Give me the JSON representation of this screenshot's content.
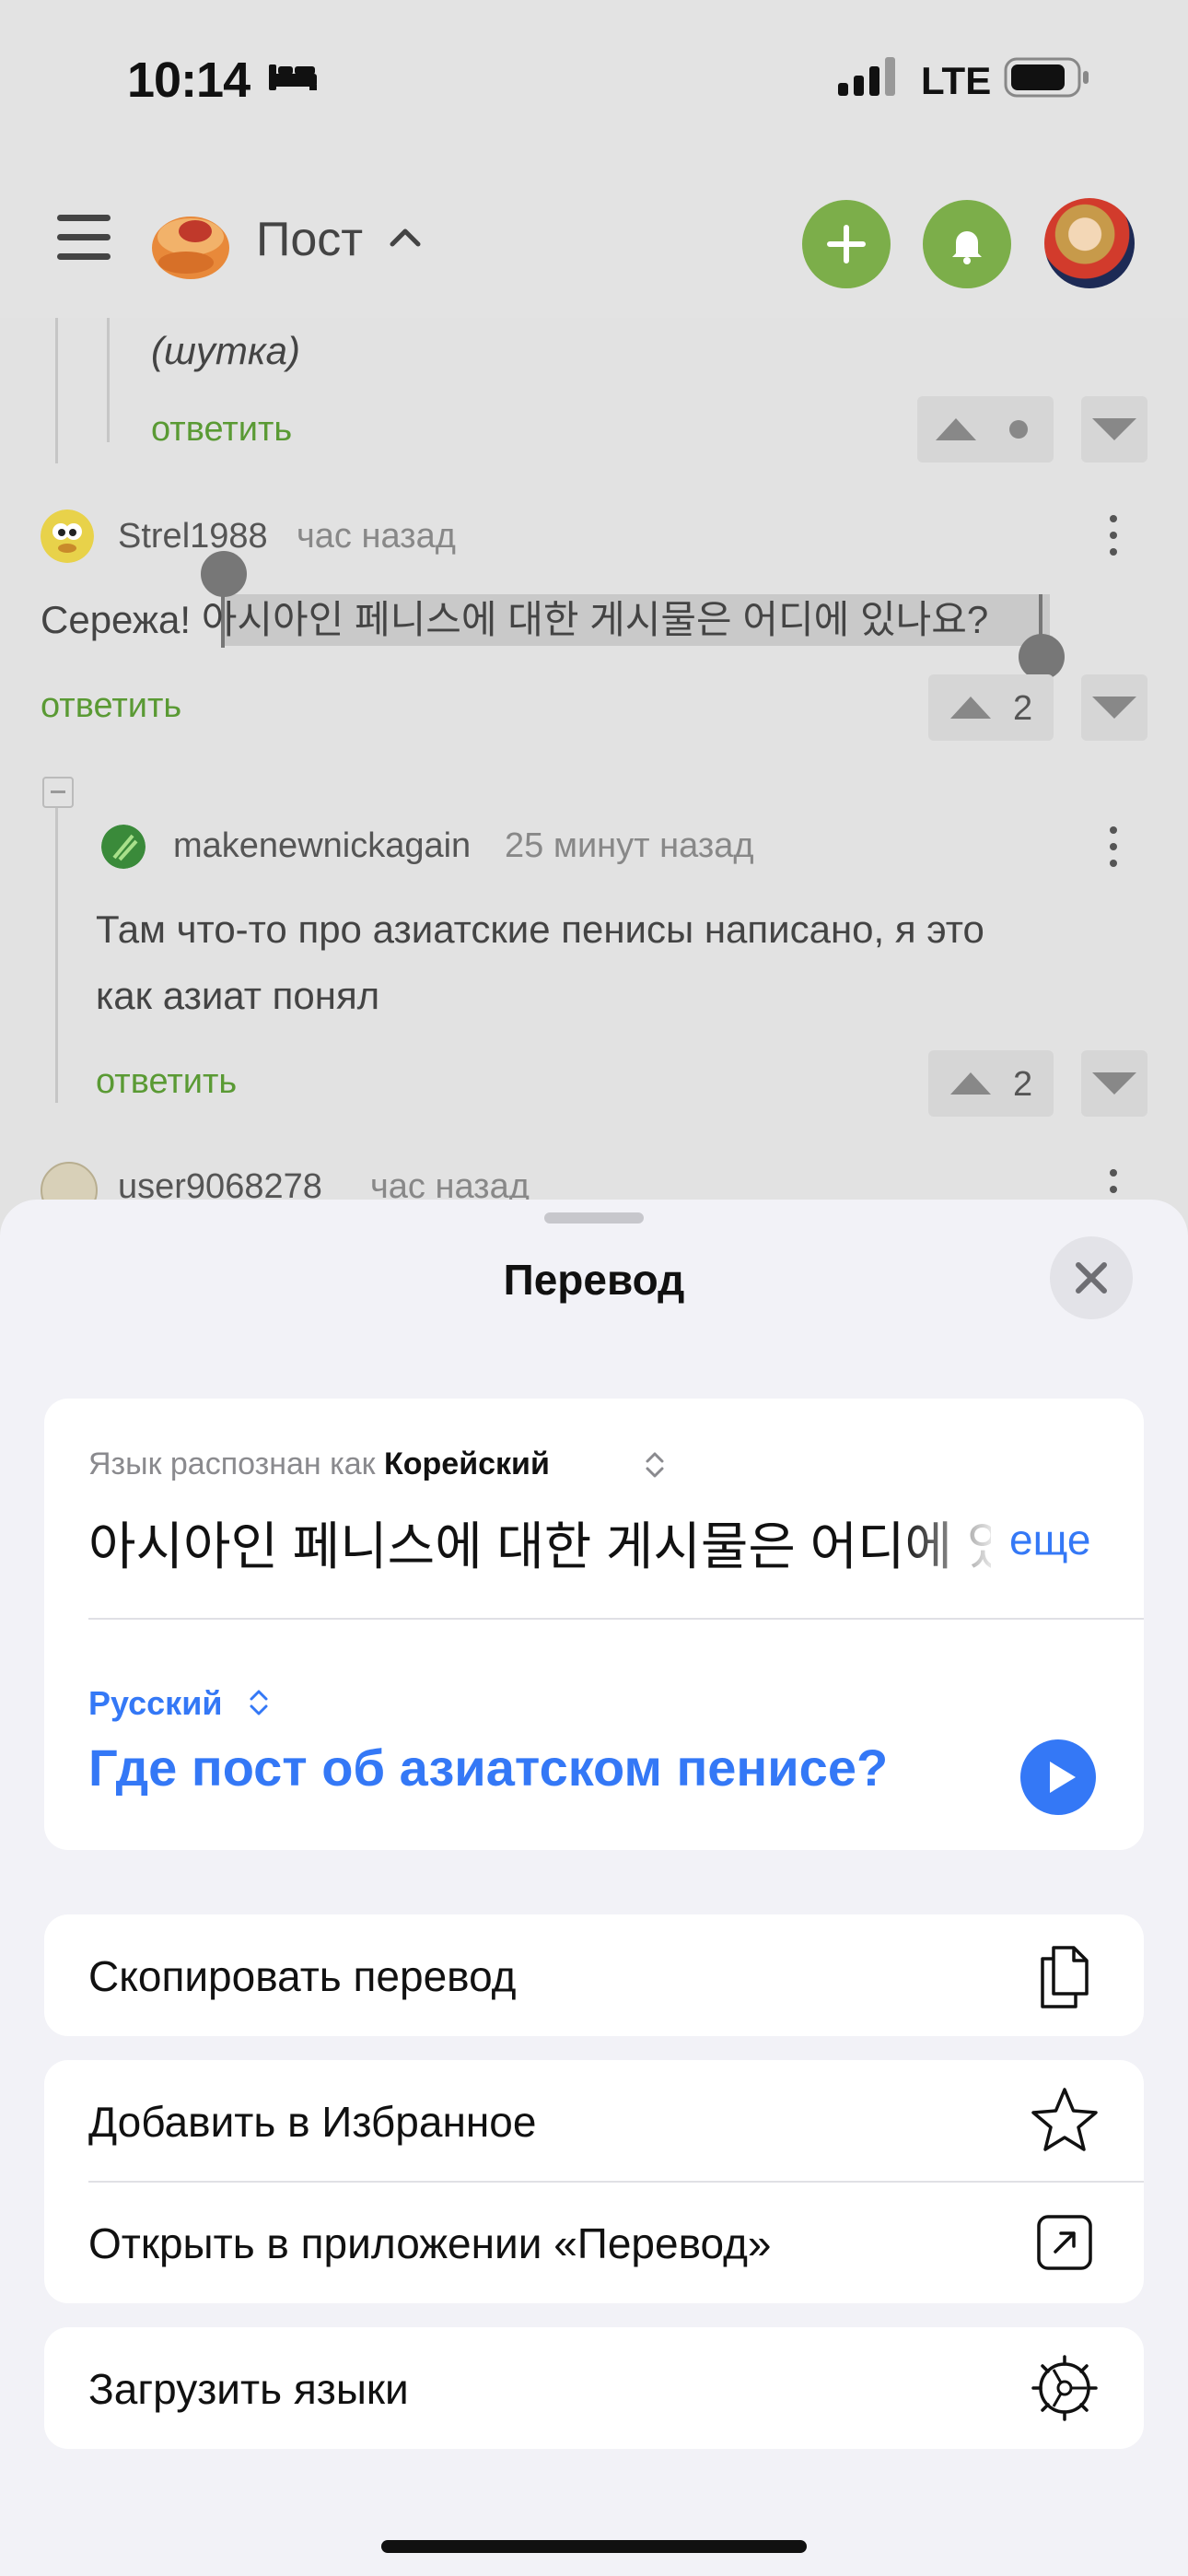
{
  "status_bar": {
    "time": "10:14",
    "network": "LTE"
  },
  "app_bar": {
    "title": "Пост"
  },
  "comments": [
    {
      "text": "(шутка)",
      "reply_label": "ответить"
    },
    {
      "username": "Strel1988",
      "time": "час назад",
      "text_prefix": "Сережа! ",
      "text_selected": "아시아인 페니스에 대한 게시물은 어디에 있나요",
      "text_suffix": "?",
      "reply_label": "ответить",
      "votes": "2"
    },
    {
      "username": "makenewnickagain",
      "time": "25 минут назад",
      "text_line1": "Там что-то про азиатские пенисы написано, я это",
      "text_line2": "как азиат понял",
      "reply_label": "ответить",
      "votes": "2"
    },
    {
      "username": "user9068278",
      "time": "час назад"
    }
  ],
  "translate_sheet": {
    "title": "Перевод",
    "detected_prefix": "Язык распознан как ",
    "detected_language": "Корейский",
    "source_text": "아시아인 페니스에 대한 게시물은 어디에 있나요?",
    "more_label": "еще",
    "target_language": "Русский",
    "translated_text": "Где пост об азиатском пенисе?",
    "actions": {
      "copy": "Скопировать перевод",
      "favorite": "Добавить в Избранное",
      "open_app": "Открыть в приложении «Перевод»",
      "download": "Загрузить языки"
    }
  },
  "colors": {
    "accent_blue": "#3478f6",
    "green": "#7cae4a",
    "reply_green": "#5a9a34"
  },
  "icons": [
    "menu-icon",
    "plus-icon",
    "bell-icon",
    "close-icon",
    "play-icon",
    "copy-icon",
    "star-icon",
    "open-external-icon",
    "download-languages-icon"
  ]
}
